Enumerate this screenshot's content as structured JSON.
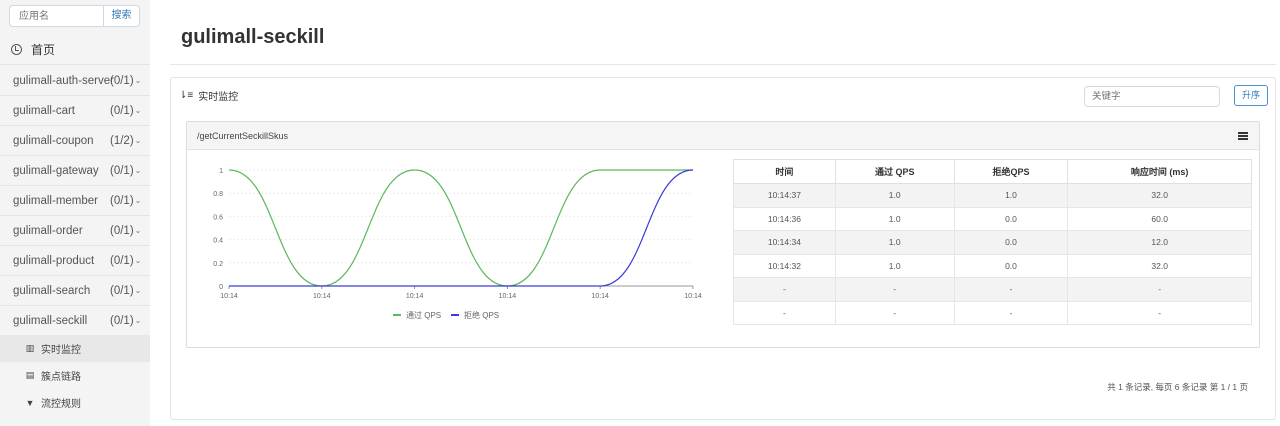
{
  "search": {
    "placeholder": "应用名",
    "button": "搜索"
  },
  "nav": {
    "home_label": "首页",
    "apps": [
      {
        "name": "gulimall-auth-server",
        "count": "(0/1)"
      },
      {
        "name": "gulimall-cart",
        "count": "(0/1)"
      },
      {
        "name": "gulimall-coupon",
        "count": "(1/2)"
      },
      {
        "name": "gulimall-gateway",
        "count": "(0/1)"
      },
      {
        "name": "gulimall-member",
        "count": "(0/1)"
      },
      {
        "name": "gulimall-order",
        "count": "(0/1)"
      },
      {
        "name": "gulimall-product",
        "count": "(0/1)"
      },
      {
        "name": "gulimall-search",
        "count": "(0/1)"
      },
      {
        "name": "gulimall-seckill",
        "count": "(0/1)"
      }
    ],
    "sub_items": [
      {
        "label": "实时监控",
        "icon": "bar-chart-icon",
        "active": true
      },
      {
        "label": "簇点链路",
        "icon": "list-icon",
        "active": false
      },
      {
        "label": "流控规则",
        "icon": "filter-icon",
        "active": false
      }
    ]
  },
  "page_title": "gulimall-seckill",
  "panel": {
    "title": "实时监控",
    "keyword_placeholder": "关键字",
    "sort_button": "升序"
  },
  "card": {
    "resource": "/getCurrentSeckillSkus"
  },
  "chart_data": {
    "type": "line",
    "x": [
      "10:14",
      "10:14",
      "10:14",
      "10:14",
      "10:14",
      "10:14"
    ],
    "ylim": [
      0,
      1
    ],
    "yticks": [
      "0",
      "0.2",
      "0.4",
      "0.6",
      "0.8",
      "1"
    ],
    "grid": true,
    "legend_position": "bottom",
    "series": [
      {
        "name": "通过 QPS",
        "color": "#5cb85c",
        "values": [
          1,
          0,
          1,
          0,
          1,
          1
        ]
      },
      {
        "name": "拒绝 QPS",
        "color": "#3c3cd6",
        "values": [
          0,
          0,
          0,
          0,
          0,
          1
        ]
      }
    ]
  },
  "table": {
    "headers": [
      "时间",
      "通过 QPS",
      "拒绝QPS",
      "响应时间 (ms)"
    ],
    "rows": [
      [
        "10:14:37",
        "1.0",
        "1.0",
        "32.0"
      ],
      [
        "10:14:36",
        "1.0",
        "0.0",
        "60.0"
      ],
      [
        "10:14:34",
        "1.0",
        "0.0",
        "12.0"
      ],
      [
        "10:14:32",
        "1.0",
        "0.0",
        "32.0"
      ],
      [
        "-",
        "-",
        "-",
        "-"
      ],
      [
        "-",
        "-",
        "-",
        "-"
      ]
    ]
  },
  "pager": "共 1 条记录, 每页 6 条记录 第 1 / 1 页"
}
